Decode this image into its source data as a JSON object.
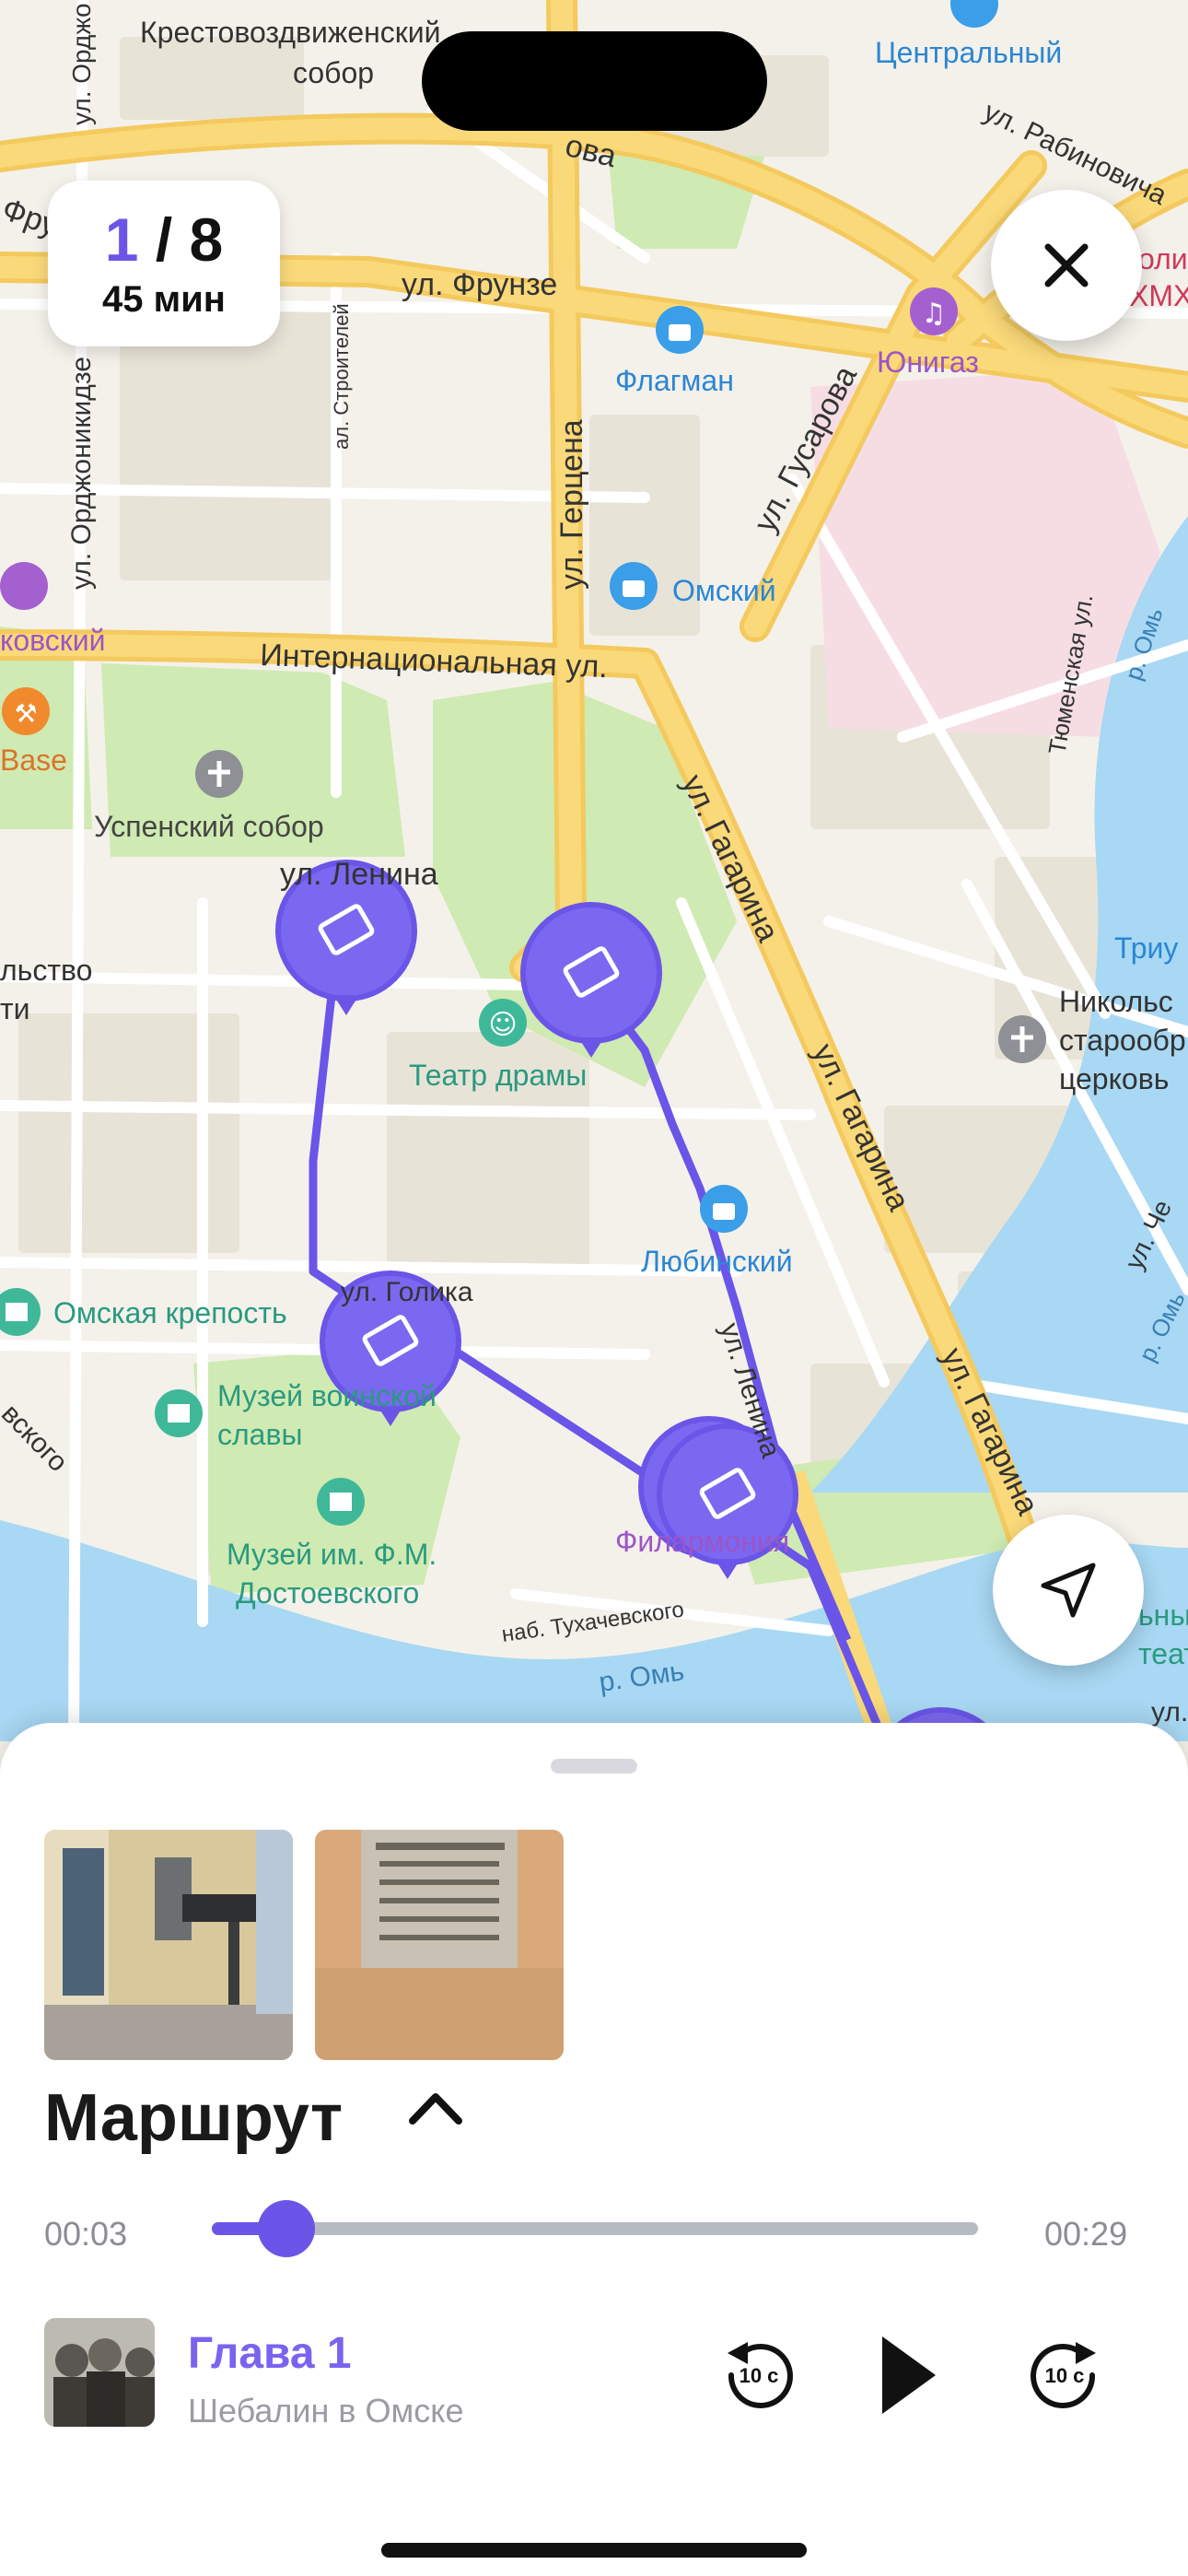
{
  "map": {
    "streets": {
      "frunze": "ул. Фрунзе",
      "internatsionalnaya": "Интернациональная ул.",
      "lenina_top": "ул. Ленина",
      "gertsena": "ул. Герцена",
      "gusarova": "ул. Гусарова",
      "gagarina_1": "ул. Гагарина",
      "gagarina_2": "ул. Гагарина",
      "gagarina_3": "ул. Гагарина",
      "ordzhonikidze": "ул. Орджоникидзе",
      "ordzh_top": "ул. Орджо",
      "stroiteley": "ал. Строителей",
      "rabinovicha": "ул. Рабиновича",
      "karla_top": "ова",
      "tyumenskaya": "Тюменская ул.",
      "om_river_1": "р. Омь",
      "om_river_2": "р. Омь",
      "om_river_3": "р. Омь",
      "tukhachevskogo": "наб. Тухачевского",
      "golika": "ул. Голика",
      "lenina_lower": "ул. Ленина",
      "chebyshev": "ул. Че",
      "evskogo": "вского",
      "frun_left": "Фрун",
      "ul_right": "ул."
    },
    "places": {
      "krestovozdvizhensky_1": "Крестовоздвиженский",
      "krestovozdvizhensky_2": "собор",
      "tsentralny": "Центральный",
      "flagman": "Флагман",
      "omsky": "Омский",
      "yunigaz": "Юнигаз",
      "uspensky": "Успенский собор",
      "teatr_dramy": "Театр драмы",
      "lyubinsky": "Любинский",
      "omskaya_krepost": "Омская крепость",
      "muzey_voinskoy_1": "Музей воинской",
      "muzey_voinskoy_2": "славы",
      "dostoevsky_1": "Музей им. Ф.М.",
      "dostoevsky_2": "Достоевского",
      "filarmoniya": "Филармония",
      "nikolsky_1": "Никольс",
      "nikolsky_2": "старообр",
      "nikolsky_3": "церковь",
      "kovsky": "ковский",
      "base": "Base",
      "lstvo_1": "льство",
      "lstvo_2": "ти",
      "triu": "Триу",
      "oli_1": "оли",
      "oli_2": "ХМХ",
      "ny_1": "ьны",
      "ny_2": "теат"
    }
  },
  "route": {
    "current": "1",
    "separator": " / ",
    "total": "8",
    "duration": "45 мин"
  },
  "player": {
    "title": "Маршрут",
    "time_elapsed": "00:03",
    "time_total": "00:29",
    "progress": 0.097,
    "chapter": "Глава 1",
    "subtitle": "Шебалин в Омске",
    "skip_back_label": "10 с",
    "skip_fwd_label": "10 с"
  },
  "colors": {
    "accent": "#6a55e8",
    "accent_light": "#7a63ef",
    "road_major": "#fad97a",
    "park": "#cfeab2",
    "water": "#a8d8f3"
  }
}
